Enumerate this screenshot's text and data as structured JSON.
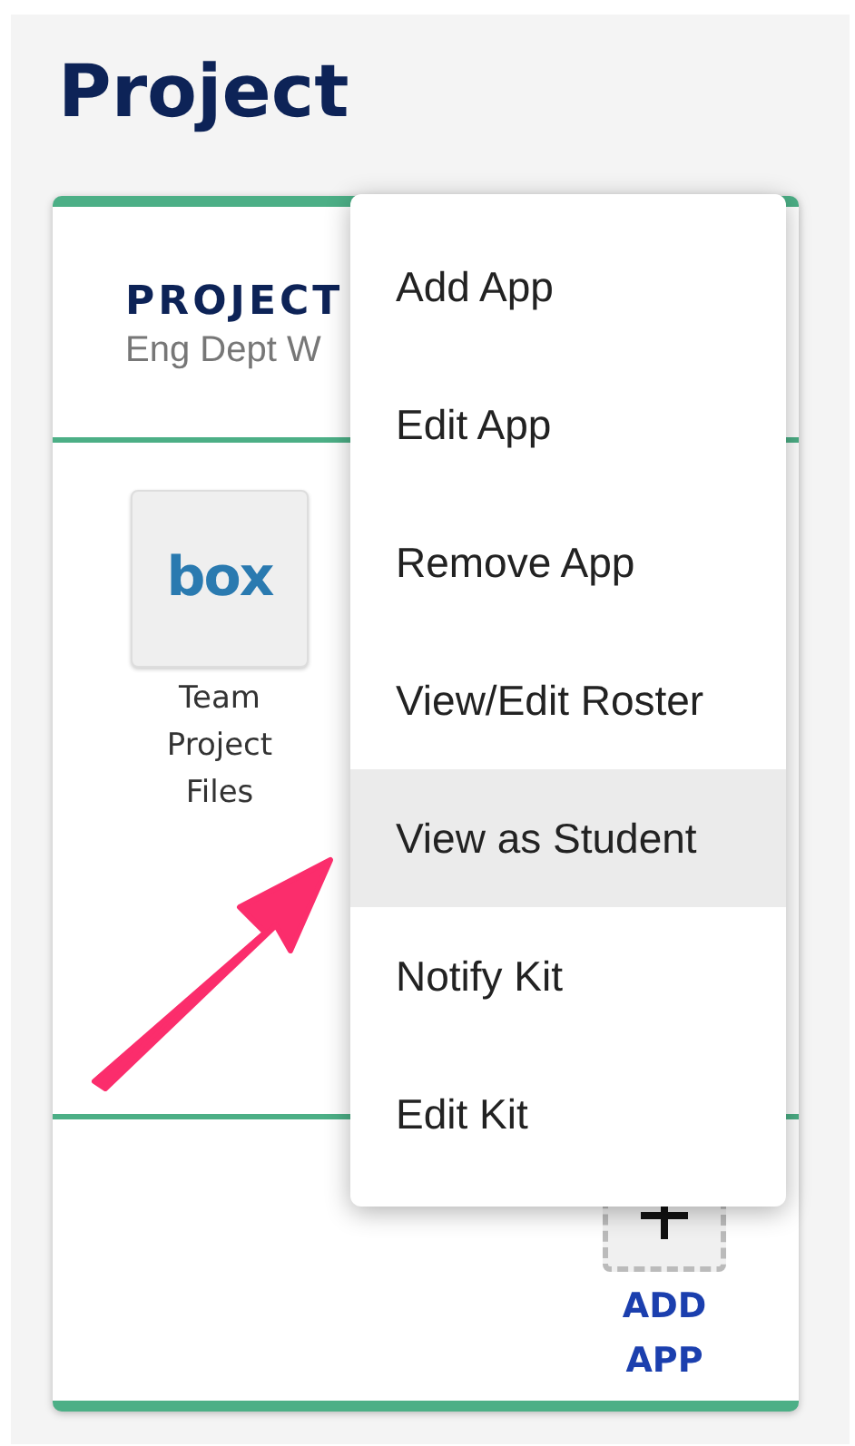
{
  "page": {
    "title": "Project"
  },
  "card": {
    "heading": "PROJECT",
    "subtitle": "Eng Dept W",
    "apps": [
      {
        "name": "Team Project Files",
        "logo": "box"
      }
    ],
    "add_app": {
      "label": "ADD APP"
    }
  },
  "menu": {
    "items": [
      {
        "label": "Add App",
        "selected": false
      },
      {
        "label": "Edit App",
        "selected": false
      },
      {
        "label": "Remove App",
        "selected": false
      },
      {
        "label": "View/Edit Roster",
        "selected": false
      },
      {
        "label": "View as Student",
        "selected": true
      },
      {
        "label": "Notify Kit",
        "selected": false
      },
      {
        "label": "Edit Kit",
        "selected": false
      }
    ]
  }
}
